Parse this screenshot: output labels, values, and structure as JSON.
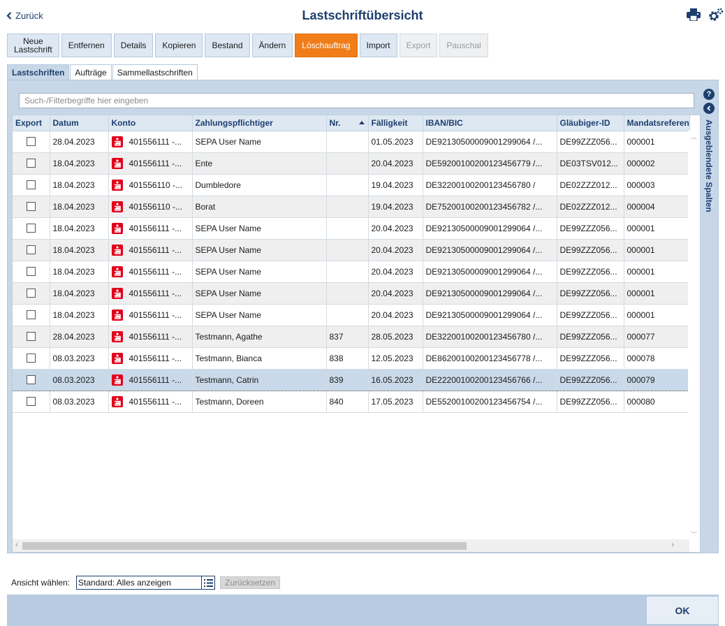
{
  "header": {
    "back_label": "Zurück",
    "title": "Lastschriftübersicht",
    "icons": [
      "print-icon",
      "settings-gear-icon"
    ]
  },
  "toolbar": [
    {
      "label": "Neue\nLastschrift",
      "state": "normal"
    },
    {
      "label": "Entfernen",
      "state": "normal"
    },
    {
      "label": "Details",
      "state": "normal"
    },
    {
      "label": "Kopieren",
      "state": "normal"
    },
    {
      "label": "Bestand",
      "state": "normal"
    },
    {
      "label": "Ändern",
      "state": "normal"
    },
    {
      "label": "Löschauftrag",
      "state": "active"
    },
    {
      "label": "Import",
      "state": "normal"
    },
    {
      "label": "Export",
      "state": "disabled"
    },
    {
      "label": "Pauschal",
      "state": "disabled"
    }
  ],
  "tabs": [
    {
      "label": "Lastschriften",
      "active": true
    },
    {
      "label": "Aufträge",
      "active": false
    },
    {
      "label": "Sammellastschriften",
      "active": false
    }
  ],
  "filter": {
    "placeholder": "Such-/Filterbegriffe hier eingeben",
    "value": ""
  },
  "table": {
    "columns": [
      "Export",
      "Datum",
      "Konto",
      "Zahlungspflichtiger",
      "Nr.",
      "Fälligkeit",
      "IBAN/BIC",
      "Gläubiger-ID",
      "Mandatsreferenz"
    ],
    "sort_column": "Nr.",
    "rows": [
      {
        "datum": "28.04.2023",
        "konto": "401556111 -...",
        "name": "SEPA User Name",
        "nr": "",
        "faellig": "01.05.2023",
        "iban": "DE92130500009001299064 /...",
        "glaeubiger": "DE99ZZZ056...",
        "mandat": "000001"
      },
      {
        "datum": "18.04.2023",
        "konto": "401556111 -...",
        "name": "Ente",
        "nr": "",
        "faellig": "20.04.2023",
        "iban": "DE59200100200123456779 /...",
        "glaeubiger": "DE03TSV012...",
        "mandat": "000002"
      },
      {
        "datum": "18.04.2023",
        "konto": "401556110 -...",
        "name": "Dumbledore",
        "nr": "",
        "faellig": "19.04.2023",
        "iban": "DE32200100200123456780 /",
        "glaeubiger": "DE02ZZZ012...",
        "mandat": "000003"
      },
      {
        "datum": "18.04.2023",
        "konto": "401556110 -...",
        "name": "Borat",
        "nr": "",
        "faellig": "19.04.2023",
        "iban": "DE75200100200123456782 /...",
        "glaeubiger": "DE02ZZZ012...",
        "mandat": "000004"
      },
      {
        "datum": "18.04.2023",
        "konto": "401556111 -...",
        "name": "SEPA User Name",
        "nr": "",
        "faellig": "20.04.2023",
        "iban": "DE92130500009001299064 /...",
        "glaeubiger": "DE99ZZZ056...",
        "mandat": "000001"
      },
      {
        "datum": "18.04.2023",
        "konto": "401556111 -...",
        "name": "SEPA User Name",
        "nr": "",
        "faellig": "20.04.2023",
        "iban": "DE92130500009001299064 /...",
        "glaeubiger": "DE99ZZZ056...",
        "mandat": "000001"
      },
      {
        "datum": "18.04.2023",
        "konto": "401556111 -...",
        "name": "SEPA User Name",
        "nr": "",
        "faellig": "20.04.2023",
        "iban": "DE92130500009001299064 /...",
        "glaeubiger": "DE99ZZZ056...",
        "mandat": "000001"
      },
      {
        "datum": "18.04.2023",
        "konto": "401556111 -...",
        "name": "SEPA User Name",
        "nr": "",
        "faellig": "20.04.2023",
        "iban": "DE92130500009001299064 /...",
        "glaeubiger": "DE99ZZZ056...",
        "mandat": "000001"
      },
      {
        "datum": "18.04.2023",
        "konto": "401556111 -...",
        "name": "SEPA User Name",
        "nr": "",
        "faellig": "20.04.2023",
        "iban": "DE92130500009001299064 /...",
        "glaeubiger": "DE99ZZZ056...",
        "mandat": "000001"
      },
      {
        "datum": "28.04.2023",
        "konto": "401556111 -...",
        "name": "Testmann, Agathe",
        "nr": "837",
        "faellig": "28.05.2023",
        "iban": "DE32200100200123456780 /...",
        "glaeubiger": "DE99ZZZ056...",
        "mandat": "000077"
      },
      {
        "datum": "08.03.2023",
        "konto": "401556111 -...",
        "name": "Testmann, Bianca",
        "nr": "838",
        "faellig": "12.05.2023",
        "iban": "DE86200100200123456778 /...",
        "glaeubiger": "DE99ZZZ056...",
        "mandat": "000078"
      },
      {
        "datum": "08.03.2023",
        "konto": "401556111 -...",
        "name": "Testmann, Catrin",
        "nr": "839",
        "faellig": "16.05.2023",
        "iban": "DE22200100200123456766 /...",
        "glaeubiger": "DE99ZZZ056...",
        "mandat": "000079",
        "selected": true
      },
      {
        "datum": "08.03.2023",
        "konto": "401556111 -...",
        "name": "Testmann, Doreen",
        "nr": "840",
        "faellig": "17.05.2023",
        "iban": "DE55200100200123456754 /...",
        "glaeubiger": "DE99ZZZ056...",
        "mandat": "000080"
      }
    ]
  },
  "side_panel": {
    "help": "?",
    "label": "Ausgeblendete Spalten"
  },
  "view": {
    "label": "Ansicht wählen:",
    "selected": "Standard: Alles anzeigen",
    "reset_label": "Zurücksetzen"
  },
  "footer": {
    "ok_label": "OK"
  },
  "colors": {
    "accent": "#f07d19",
    "brand": "#1d3f6e",
    "sparkasse_red": "#e2001a",
    "selection": "#c9d9ea"
  }
}
